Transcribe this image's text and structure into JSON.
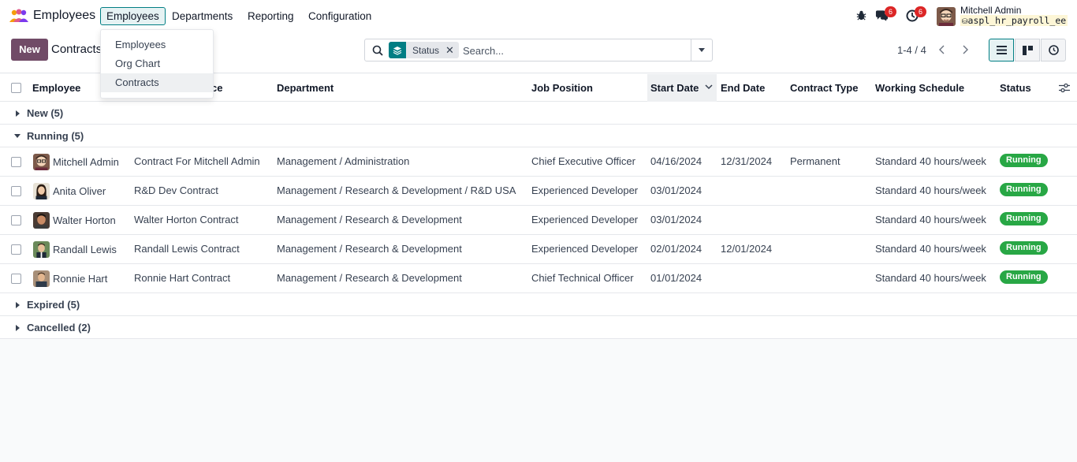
{
  "app": {
    "name": "Employees"
  },
  "topmenu": {
    "items": [
      {
        "label": "Employees"
      },
      {
        "label": "Departments"
      },
      {
        "label": "Reporting"
      },
      {
        "label": "Configuration"
      }
    ]
  },
  "dropdown": {
    "items": [
      {
        "label": "Employees"
      },
      {
        "label": "Org Chart"
      },
      {
        "label": "Contracts"
      }
    ]
  },
  "systray": {
    "messages_badge": "6",
    "activities_badge": "6"
  },
  "user": {
    "name": "Mitchell Admin",
    "db": "aspl_hr_payroll_ee"
  },
  "control": {
    "new_label": "New",
    "breadcrumb": "Contracts"
  },
  "search": {
    "facet": "Status",
    "placeholder": "Search..."
  },
  "pager": {
    "value": "1-4 / 4"
  },
  "table": {
    "columns": [
      "Employee",
      "Reference",
      "Department",
      "Job Position",
      "Start Date",
      "End Date",
      "Contract Type",
      "Working Schedule",
      "Status"
    ],
    "col_reference_visible": "ce",
    "groups": [
      {
        "label": "New (5)"
      },
      {
        "label": "Running (5)"
      },
      {
        "label": "Expired (5)"
      },
      {
        "label": "Cancelled (2)"
      }
    ],
    "rows": [
      {
        "employee": "Mitchell Admin",
        "reference": "Contract For Mitchell Admin",
        "department": "Management / Administration",
        "job": "Chief Executive Officer",
        "start": "04/16/2024",
        "end": "12/31/2024",
        "type": "Permanent",
        "schedule": "Standard 40 hours/week",
        "status": "Running"
      },
      {
        "employee": "Anita Oliver",
        "reference": "R&D Dev Contract",
        "department": "Management / Research & Development / R&D USA",
        "job": "Experienced Developer",
        "start": "03/01/2024",
        "end": "",
        "type": "",
        "schedule": "Standard 40 hours/week",
        "status": "Running"
      },
      {
        "employee": "Walter Horton",
        "reference": "Walter Horton Contract",
        "department": "Management / Research & Development",
        "job": "Experienced Developer",
        "start": "03/01/2024",
        "end": "",
        "type": "",
        "schedule": "Standard 40 hours/week",
        "status": "Running"
      },
      {
        "employee": "Randall Lewis",
        "reference": "Randall Lewis Contract",
        "department": "Management / Research & Development",
        "job": "Experienced Developer",
        "start": "02/01/2024",
        "end": "12/01/2024",
        "type": "",
        "schedule": "Standard 40 hours/week",
        "status": "Running"
      },
      {
        "employee": "Ronnie Hart",
        "reference": "Ronnie Hart Contract",
        "department": "Management / Research & Development",
        "job": "Chief Technical Officer",
        "start": "01/01/2024",
        "end": "",
        "type": "",
        "schedule": "Standard 40 hours/week",
        "status": "Running"
      }
    ]
  },
  "colors": {
    "brand": "#714b67",
    "accent": "#017e84",
    "running": "#28a745",
    "badge": "#dc2626"
  }
}
